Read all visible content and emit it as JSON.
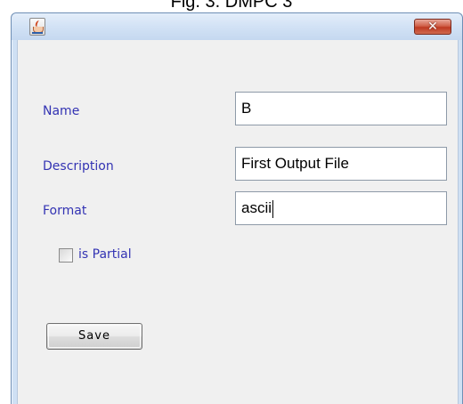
{
  "caption": "Fig. 3. DMPC 3",
  "window": {
    "icon": "java-coffee-cup-icon",
    "close_icon": "close-x-icon",
    "close_glyph": "✕"
  },
  "form": {
    "name_label": "Name",
    "name_value": "B",
    "description_label": "Description",
    "description_value": "First Output File",
    "format_label": "Format",
    "format_value": "ascii",
    "partial_label": "is Partial",
    "partial_checked": false,
    "save_label": "Save"
  },
  "colors": {
    "label_text": "#3333b3",
    "panel_background": "#f0f0f0",
    "close_button": "#c8452e"
  }
}
